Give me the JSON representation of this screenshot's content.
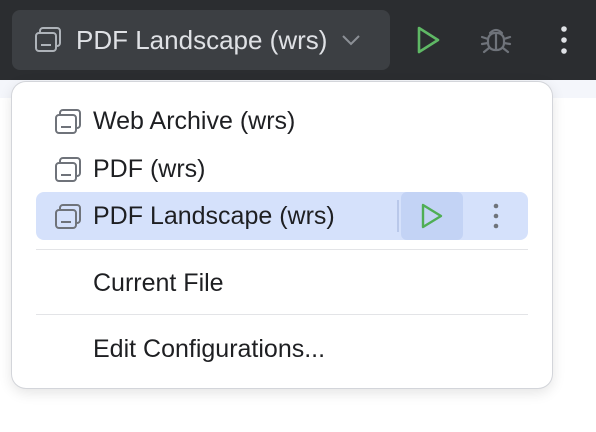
{
  "toolbar": {
    "run_config_label": "PDF Landscape (wrs)",
    "run_config_icon": "run-configuration-icon",
    "run_button_icon": "run-icon",
    "debug_button_icon": "debug-icon",
    "more_button_icon": "more-vertical-icon"
  },
  "popup": {
    "configurations": [
      {
        "label": "Web Archive (wrs)",
        "icon": "run-configuration-icon",
        "selected": false
      },
      {
        "label": "PDF (wrs)",
        "icon": "run-configuration-icon",
        "selected": false
      },
      {
        "label": "PDF Landscape (wrs)",
        "icon": "run-configuration-icon",
        "selected": true
      }
    ],
    "current_file_label": "Current File",
    "edit_configurations_label": "Edit Configurations..."
  },
  "colors": {
    "toolbar_bg": "#2b2d30",
    "run_config_bg": "#3c3f43",
    "run_green": "#5fb865",
    "selection_bg": "#d5e1fb",
    "selection_button_bg": "#c3d3f5"
  }
}
